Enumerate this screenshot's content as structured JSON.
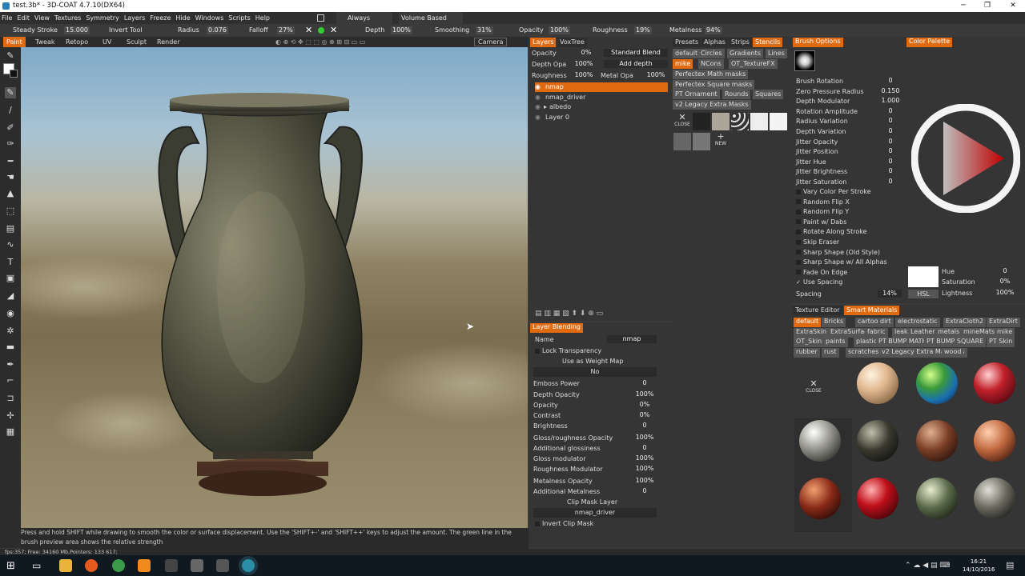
{
  "window": {
    "title": "test.3b* - 3D-COAT 4.7.10(DX64)"
  },
  "menu": [
    "File",
    "Edit",
    "View",
    "Textures",
    "Symmetry",
    "Layers",
    "Freeze",
    "Hide",
    "Windows",
    "Scripts",
    "Help"
  ],
  "menu_extra": {
    "always": "Always",
    "volume": "Volume Based"
  },
  "toolbar": {
    "steady": "Steady Stroke",
    "steady_val": "15.000",
    "invert": "Invert Tool",
    "radius": "Radius",
    "radius_val": "0.076",
    "falloff": "Falloff",
    "falloff_val": "27%",
    "depth": "Depth",
    "depth_val": "100%",
    "smoothing": "Smoothing",
    "smoothing_val": "31%",
    "opacity": "Opacity",
    "opacity_val": "100%",
    "roughness": "Roughness",
    "roughness_val": "19%",
    "metalness": "Metalness",
    "metalness_val": "94%"
  },
  "modes": [
    "Paint",
    "Tweak",
    "Retopo",
    "UV",
    "Sculpt",
    "Render"
  ],
  "camera": "Camera",
  "hint": "Press and hold SHIFT while drawing to smooth the color or surface displacement. Use the 'SHIFT+-' and 'SHIFT++' keys to adjust the amount. The green line in the brush preview area shows the relative strength",
  "status": "fps:357;  Free: 34160 Mb,Pointers: 133 617;",
  "layers": {
    "tabs": [
      "Layers",
      "VoxTree"
    ],
    "opacity_label": "Opacity",
    "opacity_val": "0%",
    "blend": "Standard Blend",
    "depth_label": "Depth Opa",
    "depth_val": "100%",
    "depth_mode": "Add depth",
    "rough_label": "Roughness",
    "rough_val": "100%",
    "metal_label": "Metal Opa",
    "metal_val": "100%",
    "items": [
      "nmap",
      "nmap_driver",
      "albedo",
      "Layer 0"
    ]
  },
  "blending": {
    "tab": "Layer Blending",
    "name_label": "Name",
    "name_val": "nmap",
    "lock": "Lock Transparency",
    "weight": "Use as Weight Map",
    "weight_val": "No",
    "params": [
      {
        "label": "Emboss Power",
        "val": "0"
      },
      {
        "label": "Depth Opacity",
        "val": "100%"
      },
      {
        "label": "Opacity",
        "val": "0%"
      },
      {
        "label": "Contrast",
        "val": "0%"
      },
      {
        "label": "Brightness",
        "val": "0"
      },
      {
        "label": "Gloss/roughness Opacity",
        "val": "100%"
      },
      {
        "label": "Additional glossiness",
        "val": "0"
      },
      {
        "label": "Gloss modulator",
        "val": "100%"
      },
      {
        "label": "Roughness Modulator",
        "val": "100%"
      },
      {
        "label": "Metalness Opacity",
        "val": "100%"
      },
      {
        "label": "Additional Metalness",
        "val": "0"
      }
    ],
    "clip": "Clip Mask Layer",
    "clip_val": "nmap_driver",
    "invert": "Invert Clip Mask"
  },
  "stencils": {
    "tabs": [
      "Presets",
      "Alphas",
      "Strips",
      "Stencils"
    ],
    "row1": [
      "default",
      "Circles",
      "Gradients",
      "Lines"
    ],
    "row2": [
      "mike",
      "NCons",
      "OT_TextureFX"
    ],
    "row3": [
      "Perfectex Math masks"
    ],
    "row4": [
      "Perfectex Square masks"
    ],
    "row5": [
      "PT Ornament",
      "Rounds",
      "Squares"
    ],
    "row6": [
      "v2 Legacy Extra Masks"
    ],
    "close": "CLOSE",
    "new": "NEW"
  },
  "brush": {
    "tab": "Brush Options",
    "params": [
      {
        "label": "Brush Rotation",
        "val": "0"
      },
      {
        "label": "Zero Pressure Radius",
        "val": "0.150"
      },
      {
        "label": "Depth Modulator",
        "val": "1.000"
      },
      {
        "label": "Rotation Amplitude",
        "val": "0"
      },
      {
        "label": "Radius Variation",
        "val": "0"
      },
      {
        "label": "Depth Variation",
        "val": "0"
      },
      {
        "label": "Jitter Opacity",
        "val": "0"
      },
      {
        "label": "Jitter Position",
        "val": "0"
      },
      {
        "label": "Jitter Hue",
        "val": "0"
      },
      {
        "label": "Jitter Brightness",
        "val": "0"
      },
      {
        "label": "Jitter Saturation",
        "val": "0"
      }
    ],
    "checks": [
      "Vary Color Per Stroke",
      "Random Flip X",
      "Random Flip Y",
      "Paint w/ Dabs",
      "Rotate Along Stroke",
      "Skip Eraser",
      "Sharp Shape (Old Style)",
      "Sharp Shape w/ All Alphas",
      "Fade On Edge",
      "Use Spacing"
    ],
    "spacing_label": "Spacing",
    "spacing_val": "14%"
  },
  "palette": {
    "tab": "Color Palette",
    "hue_label": "Hue",
    "hue_val": "0",
    "sat_label": "Saturation",
    "sat_val": "0%",
    "light_label": "Lightness",
    "light_val": "100%",
    "mode": "HSL"
  },
  "materials": {
    "tabs": [
      "Texture Editor",
      "Smart Materials"
    ],
    "row1": [
      "default",
      "Bricks",
      "cartoon",
      "dirt",
      "electrostatic",
      "ExtraCloth2",
      "ExtraDirt"
    ],
    "row2": [
      "ExtraSkin",
      "ExtraSurface",
      "fabric",
      "leaks",
      "Leather",
      "metals",
      "mineMats",
      "mike"
    ],
    "row3": [
      "OT_Skin",
      "paints",
      "plastic",
      "PT BUMP MATH",
      "PT BUMP SQUARE",
      "PT Skin"
    ],
    "row4": [
      "rubber",
      "rust",
      "scratches",
      "v2 Legacy Extra Materials",
      "wood"
    ],
    "close": "CLOSE"
  },
  "clock": {
    "time": "16:21",
    "date": "14/10/2016"
  }
}
